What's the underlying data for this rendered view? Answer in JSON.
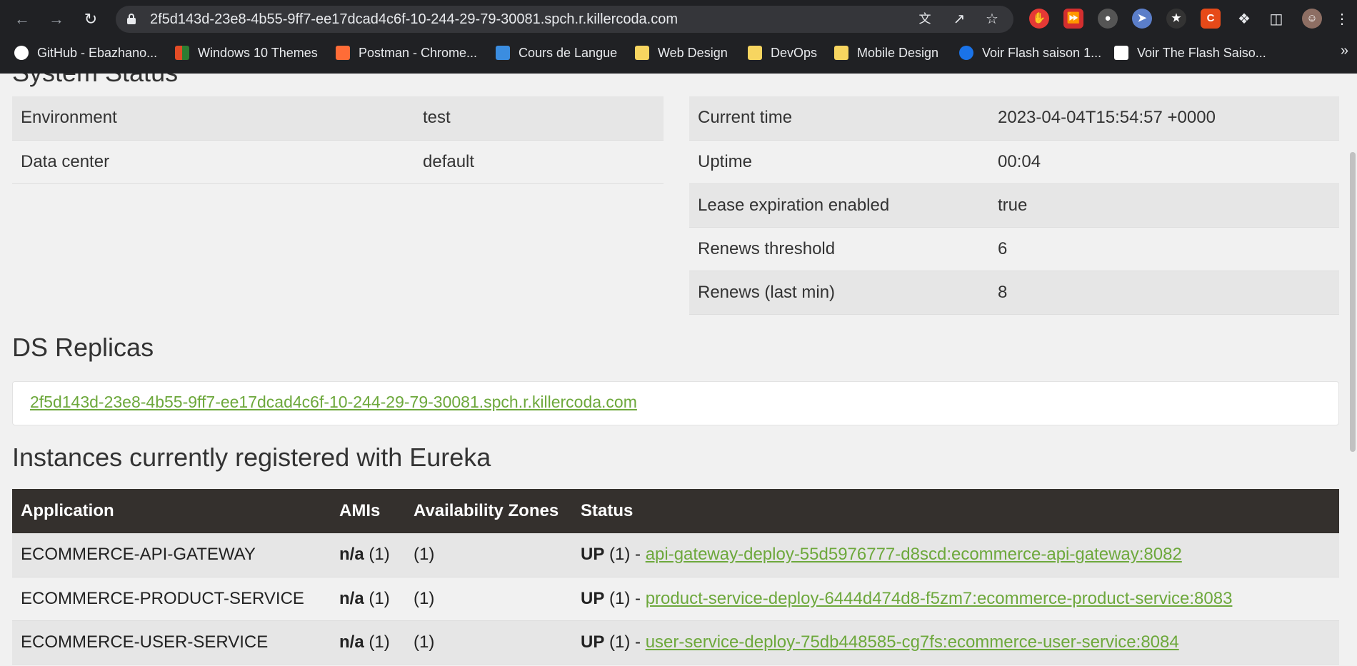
{
  "browser": {
    "url": "2f5d143d-23e8-4b55-9ff7-ee17dcad4c6f-10-244-29-79-30081.spch.r.killercoda.com",
    "bookmarks": [
      {
        "label": "GitHub - Ebazhano...",
        "color": "#ffffff"
      },
      {
        "label": "Windows 10 Themes",
        "color": "#e34c26"
      },
      {
        "label": "Postman - Chrome...",
        "color": "#ff6c37"
      },
      {
        "label": "Cours de Langue",
        "color": "#3b8de0"
      },
      {
        "label": "Web Design",
        "color": "#f7d560"
      },
      {
        "label": "DevOps",
        "color": "#f7d560"
      },
      {
        "label": "Mobile Design",
        "color": "#f7d560"
      },
      {
        "label": "Voir Flash saison 1...",
        "color": "#1a73e8"
      },
      {
        "label": "Voir The Flash Saiso...",
        "color": "#ffffff"
      }
    ],
    "more": "»"
  },
  "system_status": {
    "left": [
      {
        "key": "Environment",
        "value": "test"
      },
      {
        "key": "Data center",
        "value": "default"
      }
    ],
    "right": [
      {
        "key": "Current time",
        "value": "2023-04-04T15:54:57 +0000"
      },
      {
        "key": "Uptime",
        "value": "00:04"
      },
      {
        "key": "Lease expiration enabled",
        "value": "true"
      },
      {
        "key": "Renews threshold",
        "value": "6"
      },
      {
        "key": "Renews (last min)",
        "value": "8"
      }
    ]
  },
  "replicas": {
    "title": "DS Replicas",
    "link": "2f5d143d-23e8-4b55-9ff7-ee17dcad4c6f-10-244-29-79-30081.spch.r.killercoda.com"
  },
  "instances": {
    "title": "Instances currently registered with Eureka",
    "headers": [
      "Application",
      "AMIs",
      "Availability Zones",
      "Status"
    ],
    "rows": [
      {
        "app": "ECOMMERCE-API-GATEWAY",
        "ami": "n/a",
        "ami_count": "(1)",
        "zones": "(1)",
        "status": "UP",
        "status_count": "(1) -",
        "link": "api-gateway-deploy-55d5976777-d8scd:ecommerce-api-gateway:8082"
      },
      {
        "app": "ECOMMERCE-PRODUCT-SERVICE",
        "ami": "n/a",
        "ami_count": "(1)",
        "zones": "(1)",
        "status": "UP",
        "status_count": "(1) -",
        "link": "product-service-deploy-6444d474d8-f5zm7:ecommerce-product-service:8083"
      },
      {
        "app": "ECOMMERCE-USER-SERVICE",
        "ami": "n/a",
        "ami_count": "(1)",
        "zones": "(1)",
        "status": "UP",
        "status_count": "(1) -",
        "link": "user-service-deploy-75db448585-cg7fs:ecommerce-user-service:8084"
      }
    ]
  }
}
